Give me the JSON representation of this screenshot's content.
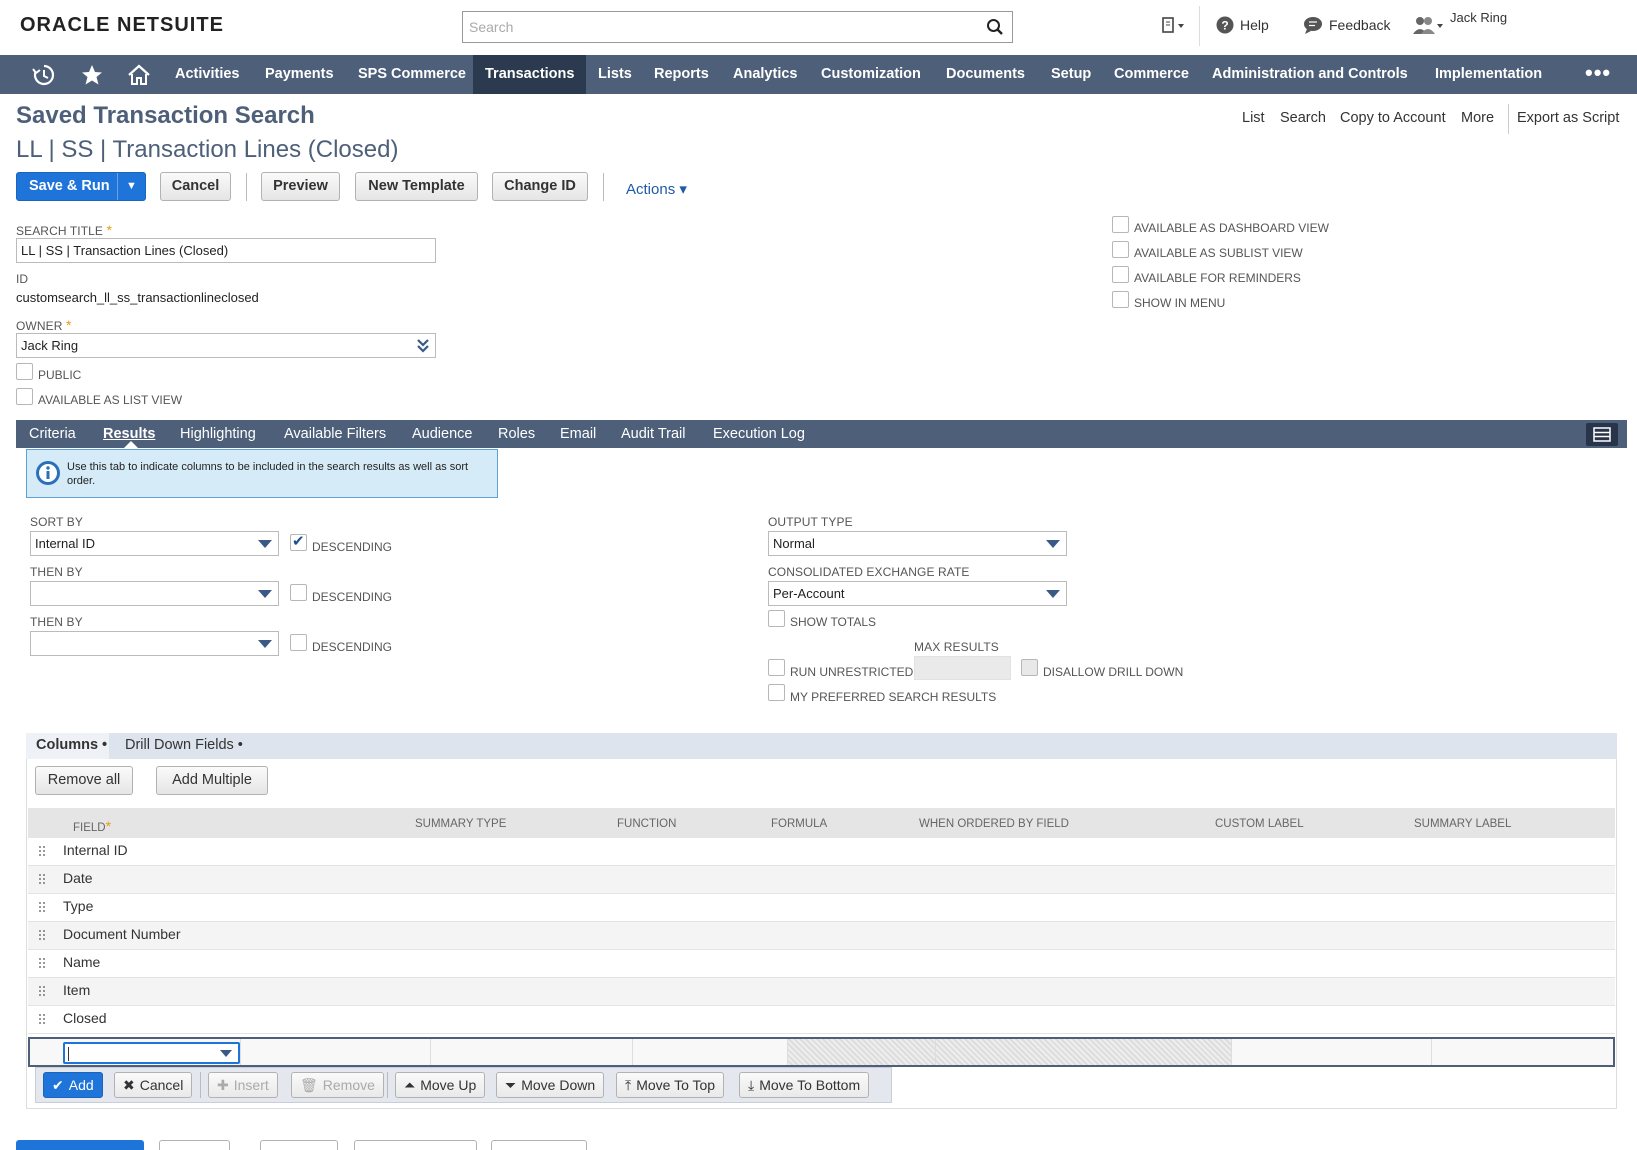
{
  "header": {
    "logo_oracle": "ORACLE",
    "logo_netsuite": "NETSUITE",
    "search_placeholder": "Search",
    "help": "Help",
    "feedback": "Feedback",
    "user": "Jack Ring"
  },
  "nav": {
    "items": [
      "Activities",
      "Payments",
      "SPS Commerce",
      "Transactions",
      "Lists",
      "Reports",
      "Analytics",
      "Customization",
      "Documents",
      "Setup",
      "Commerce",
      "Administration and Controls",
      "Implementation"
    ],
    "active": "Transactions",
    "more": "•••"
  },
  "page": {
    "title": "Saved Transaction Search",
    "record_title": "LL | SS | Transaction Lines (Closed)",
    "links": [
      "List",
      "Search",
      "Copy to Account",
      "More",
      "Export as Script"
    ]
  },
  "buttons": {
    "save_run": "Save & Run",
    "save_run_caret": "▼",
    "cancel": "Cancel",
    "preview": "Preview",
    "new_template": "New Template",
    "change_id": "Change ID",
    "actions": "Actions ▾"
  },
  "form": {
    "search_title_label": "SEARCH TITLE",
    "search_title_value": "LL | SS | Transaction Lines (Closed)",
    "id_label": "ID",
    "id_value": "customsearch_ll_ss_transactionlineclosed",
    "owner_label": "OWNER",
    "owner_value": "Jack Ring",
    "public_label": "PUBLIC",
    "list_view_label": "AVAILABLE AS LIST VIEW",
    "dashboard_view_label": "AVAILABLE AS DASHBOARD VIEW",
    "sublist_view_label": "AVAILABLE AS SUBLIST VIEW",
    "reminders_label": "AVAILABLE FOR REMINDERS",
    "show_menu_label": "SHOW IN MENU"
  },
  "subtabs": {
    "items": [
      "Criteria",
      "Results",
      "Highlighting",
      "Available Filters",
      "Audience",
      "Roles",
      "Email",
      "Audit Trail",
      "Execution Log"
    ],
    "active": "Results"
  },
  "results": {
    "info": "Use this tab to indicate columns to be included in the search results as well as sort order.",
    "sort_by_label": "SORT BY",
    "sort_by_value": "Internal ID",
    "descending_label": "DESCENDING",
    "then_by_label": "THEN BY",
    "output_type_label": "OUTPUT TYPE",
    "output_type_value": "Normal",
    "exchange_rate_label": "CONSOLIDATED EXCHANGE RATE",
    "exchange_rate_value": "Per-Account",
    "show_totals_label": "SHOW TOTALS",
    "max_results_label": "MAX RESULTS",
    "run_unrestricted_label": "RUN UNRESTRICTED",
    "disallow_drill_label": "DISALLOW DRILL DOWN",
    "preferred_label": "MY PREFERRED SEARCH RESULTS"
  },
  "columns_tabs": {
    "columns": "Columns",
    "drill": "Drill Down Fields",
    "remove_all": "Remove all",
    "add_multiple": "Add Multiple"
  },
  "table": {
    "headers": [
      "FIELD",
      "SUMMARY TYPE",
      "FUNCTION",
      "FORMULA",
      "WHEN ORDERED BY FIELD",
      "CUSTOM LABEL",
      "SUMMARY LABEL"
    ],
    "rows": [
      "Internal ID",
      "Date",
      "Type",
      "Document Number",
      "Name",
      "Item",
      "Closed"
    ]
  },
  "machine_buttons": {
    "add": "Add",
    "cancel": "Cancel",
    "insert": "Insert",
    "remove": "Remove",
    "move_up": "Move Up",
    "move_down": "Move Down",
    "move_top": "Move To Top",
    "move_bottom": "Move To Bottom"
  },
  "colors": {
    "nav": "#4d5f79",
    "nav_active": "#2b3a4f",
    "primary": "#1e74d8",
    "required": "#e89a16"
  }
}
